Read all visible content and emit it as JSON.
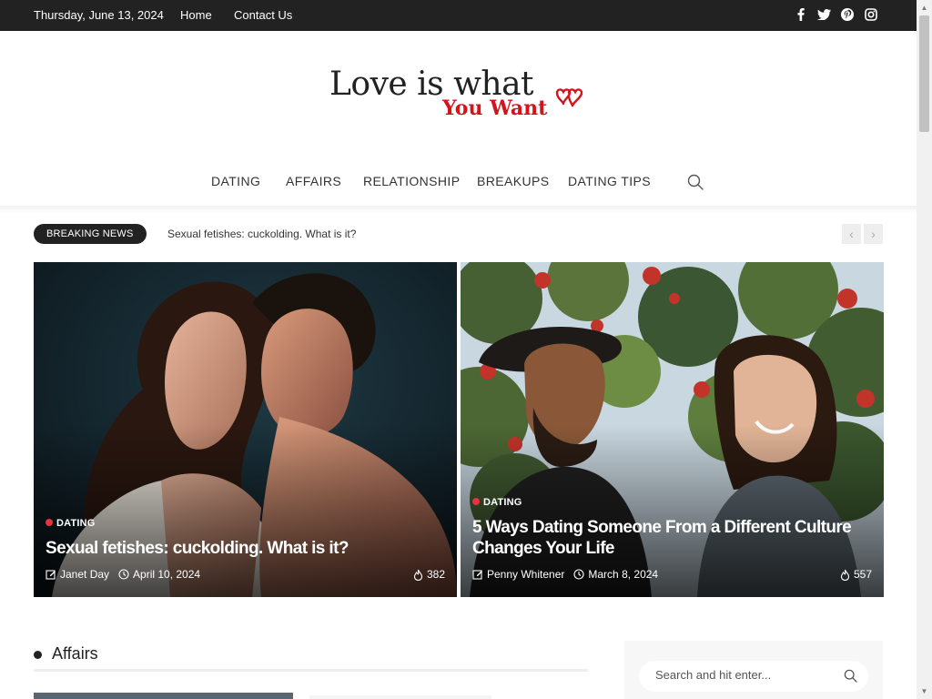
{
  "topbar": {
    "date": "Thursday, June 13, 2024",
    "links": [
      "Home",
      "Contact Us"
    ],
    "social_icons": [
      "facebook-icon",
      "twitter-icon",
      "pinterest-icon",
      "instagram-icon"
    ]
  },
  "logo": {
    "line1": "Love is what",
    "line2": "You Want",
    "accent_color": "#d3141c"
  },
  "nav": {
    "items": [
      "DATING",
      "AFFAIRS",
      "RELATIONSHIP",
      "BREAKUPS",
      "DATING TIPS"
    ],
    "search_icon": "search-icon"
  },
  "breaking": {
    "label": "BREAKING NEWS",
    "headline": "Sexual fetishes: cuckolding. What is it?",
    "prev": "‹",
    "next": "›"
  },
  "featured": [
    {
      "category": "DATING",
      "title": "Sexual fetishes: cuckolding. What is it?",
      "author": "Janet Day",
      "date": "April 10, 2024",
      "views": "382"
    },
    {
      "category": "DATING",
      "title": "5 Ways Dating Someone From a Different Culture Changes Your Life",
      "author": "Penny Whitener",
      "date": "March 8, 2024",
      "views": "557"
    }
  ],
  "section": {
    "title": "Affairs"
  },
  "sidebar": {
    "search_placeholder": "Search and hit enter..."
  },
  "colors": {
    "topbar_bg": "#222222",
    "category_dot": "#e3343f"
  }
}
